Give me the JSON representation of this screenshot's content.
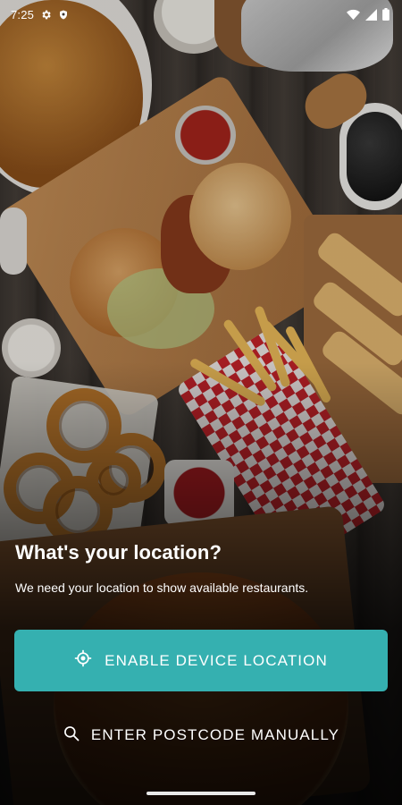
{
  "status_bar": {
    "time": "7:25",
    "icons_left": [
      "gear-icon",
      "shield-icon"
    ],
    "icons_right": [
      "wifi-icon",
      "cellular-signal-icon",
      "battery-icon"
    ]
  },
  "location_prompt": {
    "title": "What's your location?",
    "subtitle": "We need your location to show available restaurants."
  },
  "actions": {
    "enable_location": {
      "label": "ENABLE DEVICE LOCATION",
      "icon": "location-target-icon"
    },
    "enter_postcode": {
      "label": "ENTER POSTCODE MANUALLY",
      "icon": "search-icon"
    }
  },
  "colors": {
    "accent": "#35b0b0",
    "text": "#ffffff"
  }
}
